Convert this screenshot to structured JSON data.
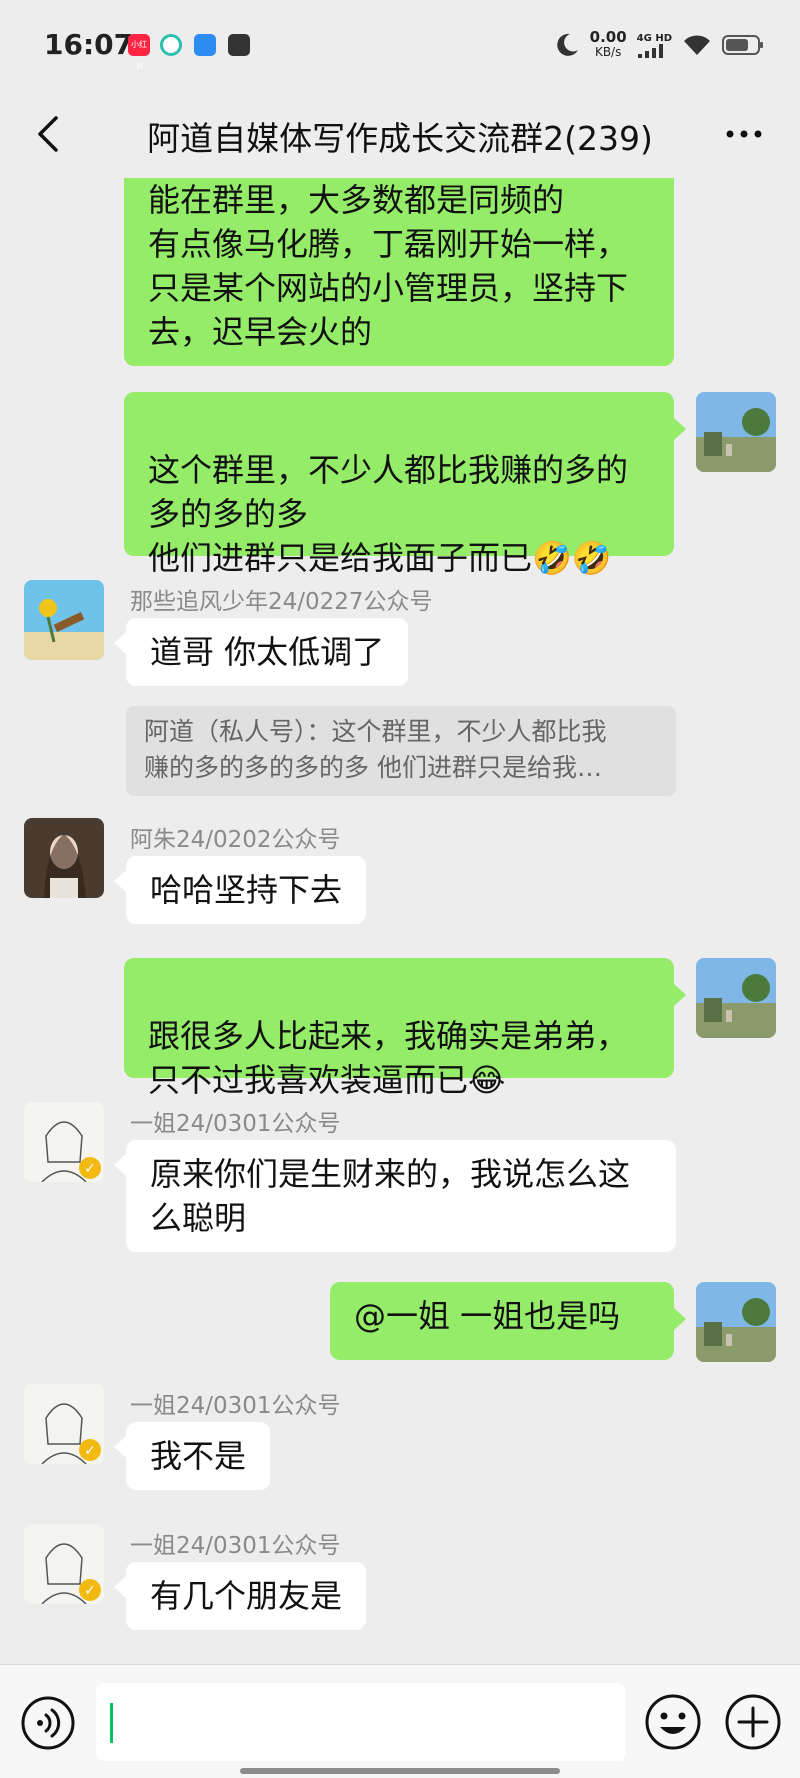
{
  "status_bar": {
    "time": "16:07",
    "net_speed_value": "0.00",
    "net_speed_unit": "KB/s",
    "signal_label": "4G HD",
    "app_icons": [
      "xiaohongshu-icon",
      "sync-icon",
      "wallet-icon",
      "bag-icon"
    ],
    "right_icons": [
      "moon-icon",
      "signal-icon",
      "wifi-icon",
      "battery-icon"
    ]
  },
  "header": {
    "title": "阿道自媒体写作成长交流群2(239)"
  },
  "messages": [
    {
      "id": 1,
      "direction": "out",
      "text": "能在群里，大多数都是同频的\n有点像马化腾，丁磊刚开始一样，\n只是某个网站的小管理员，坚持下\n去，迟早会火的"
    },
    {
      "id": 2,
      "direction": "out",
      "text": "这个群里，不少人都比我赚的多的\n多的多的多\n他们进群只是给我面子而已",
      "emoji": "🤣🤣"
    },
    {
      "id": 3,
      "direction": "in",
      "sender": "那些追风少年24/0227公众号",
      "text": "道哥  你太低调了",
      "quote_lines": [
        "阿道（私人号）：这个群里，不少人都比我",
        "赚的多的多的多的多 他们进群只是给我…"
      ]
    },
    {
      "id": 4,
      "direction": "in",
      "sender": "阿朱24/0202公众号",
      "text": "哈哈坚持下去"
    },
    {
      "id": 5,
      "direction": "out",
      "text": "跟很多人比起来，我确实是弟弟，\n只不过我喜欢装逼而已",
      "emoji": "😂"
    },
    {
      "id": 6,
      "direction": "in",
      "sender": "一姐24/0301公众号",
      "text": "原来你们是生财来的，我说怎么这\n么聪明"
    },
    {
      "id": 7,
      "direction": "out",
      "text": "@一姐  一姐也是吗"
    },
    {
      "id": 8,
      "direction": "in",
      "sender": "一姐24/0301公众号",
      "text": "我不是"
    },
    {
      "id": 9,
      "direction": "in",
      "sender": "一姐24/0301公众号",
      "text": "有几个朋友是"
    }
  ],
  "input_bar": {
    "value": "",
    "left_icon": "voice-icon",
    "right_icons": [
      "emoji-icon",
      "add-icon"
    ]
  },
  "colors": {
    "background": "#ededed",
    "outgoing_bubble": "#95ec69",
    "incoming_bubble": "#ffffff",
    "accent": "#07c160"
  }
}
